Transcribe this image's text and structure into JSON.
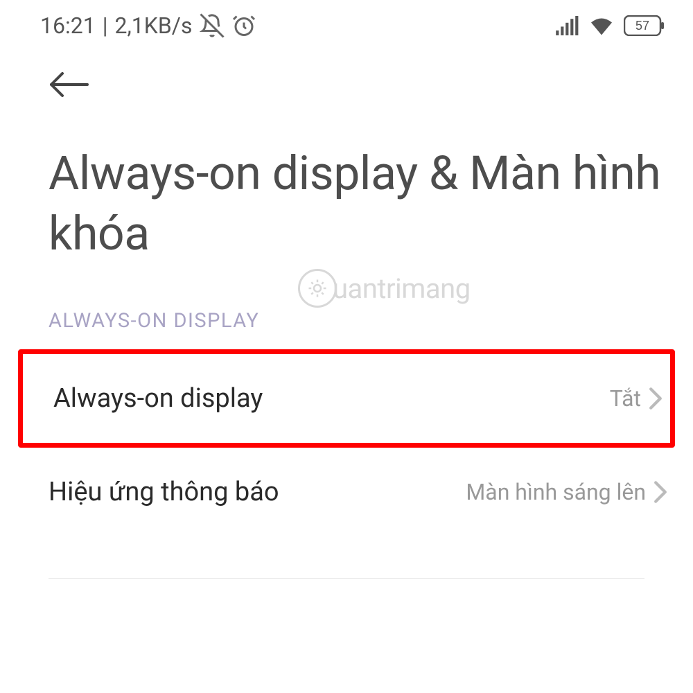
{
  "status_bar": {
    "time": "16:21",
    "separator": "|",
    "speed": "2,1KB/s",
    "battery": "57"
  },
  "page": {
    "title": "Always-on display & Màn hình khóa"
  },
  "section": {
    "label": "ALWAYS-ON DISPLAY"
  },
  "settings": [
    {
      "label": "Always-on display",
      "value": "Tắt"
    },
    {
      "label": "Hiệu ứng thông báo",
      "value": "Màn hình sáng lên"
    }
  ],
  "watermark": {
    "text": "uantrimang"
  }
}
